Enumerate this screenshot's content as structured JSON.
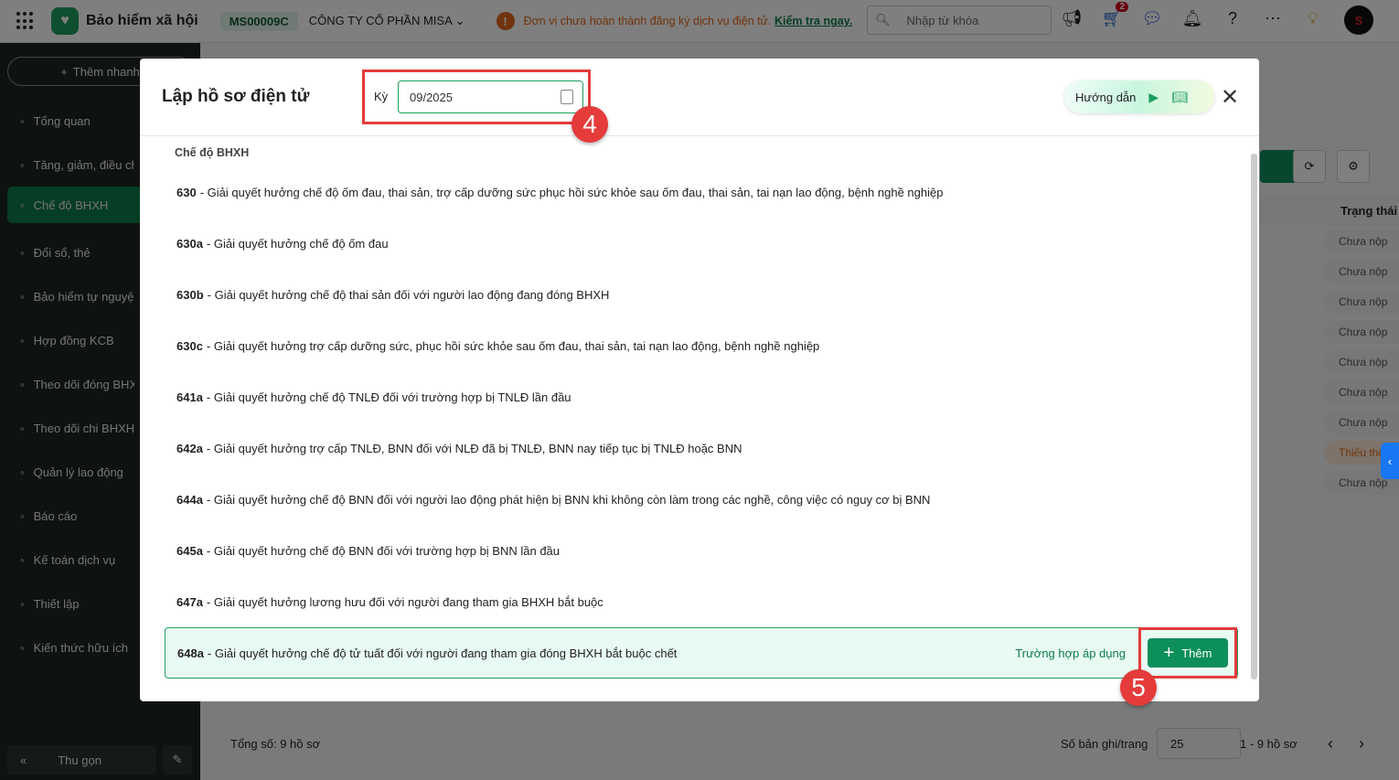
{
  "topbar": {
    "app_name": "Bảo hiểm xã hội",
    "company_code": "MS00009C",
    "company_name": "CÔNG TY CỔ PHẦN MISA",
    "warning": "Đơn vị chưa hoàn thành đăng ký dịch vụ điện tử.",
    "warning_link": "Kiểm tra ngay.",
    "search_placeholder": "Nhập từ khóa",
    "cart_badge": "2"
  },
  "sidebar": {
    "quick_add": "Thêm nhanh",
    "items": [
      {
        "label": "Tổng quan",
        "icon": "home-icon"
      },
      {
        "label": "Tăng, giảm, điều chỉnh",
        "icon": "user-icon"
      },
      {
        "label": "Chế độ BHXH",
        "icon": "shield-icon"
      },
      {
        "label": "Đổi sổ, thẻ",
        "icon": "card-icon"
      },
      {
        "label": "Bảo hiểm tự nguyện",
        "icon": "shield-icon"
      },
      {
        "label": "Hợp đồng KCB",
        "icon": "contract-icon"
      },
      {
        "label": "Theo dõi đóng BHXH",
        "icon": "doc-icon"
      },
      {
        "label": "Theo dõi chi BHXH",
        "icon": "doc-icon"
      },
      {
        "label": "Quản lý lao động",
        "icon": "users-icon"
      },
      {
        "label": "Báo cáo",
        "icon": "report-icon"
      },
      {
        "label": "Kế toán dịch vụ",
        "icon": "service-icon"
      },
      {
        "label": "Thiết lập",
        "icon": "gear-icon"
      },
      {
        "label": "Kiến thức hữu ích",
        "icon": "bulb-icon"
      }
    ],
    "collapse": "Thu gọn"
  },
  "background": {
    "column_header": "Trạng thái",
    "statuses": [
      "Chưa nộp",
      "Chưa nộp",
      "Chưa nộp",
      "Chưa nộp",
      "Chưa nộp",
      "Chưa nộp",
      "Chưa nộp",
      "Thiếu thông tin",
      "Chưa nộp"
    ],
    "total": "Tổng số: 9 hồ sơ",
    "per_page_label": "Số bản ghi/trang",
    "per_page": "25",
    "range": "1 - 9 hồ sơ"
  },
  "modal": {
    "title": "Lập hồ sơ điện tử",
    "period_label": "Kỳ",
    "period_value": "09/2025",
    "guide": "Hướng dẫn",
    "section": "Chế độ BHXH",
    "items": [
      {
        "code": "630",
        "text": "Giải quyết hưởng chế độ ốm đau, thai sản, trợ cấp dưỡng sức phục hồi sức khỏe sau ốm đau, thai sản, tai nạn lao động, bệnh nghề nghiệp"
      },
      {
        "code": "630a",
        "text": "Giải quyết hưởng chế độ ốm đau"
      },
      {
        "code": "630b",
        "text": "Giải quyết hưởng chế độ thai sản đối với người lao động đang đóng BHXH"
      },
      {
        "code": "630c",
        "text": "Giải quyết hưởng trợ cấp dưỡng sức, phục hồi sức khỏe sau ốm đau, thai sản, tai nạn lao động, bệnh nghề nghiệp"
      },
      {
        "code": "641a",
        "text": "Giải quyết hưởng chế độ TNLĐ đối với trường hợp bị TNLĐ lần đầu"
      },
      {
        "code": "642a",
        "text": "Giải quyết hưởng trợ cấp TNLĐ, BNN đối với NLĐ đã bị TNLĐ, BNN nay tiếp tục bị TNLĐ hoặc BNN"
      },
      {
        "code": "644a",
        "text": "Giải quyết hưởng chế độ BNN đối với người lao động phát hiện bị BNN khi không còn làm trong các nghề, công việc có nguy cơ bị BNN"
      },
      {
        "code": "645a",
        "text": "Giải quyết hưởng chế độ BNN đối với trường hợp bị BNN lần đầu"
      },
      {
        "code": "647a",
        "text": "Giải quyết hưởng lương hưu đối với người đang tham gia BHXH bắt buộc"
      },
      {
        "code": "648a",
        "text": "Giải quyết hưởng chế độ tử tuất đối với người đang tham gia đóng BHXH bắt buộc chết"
      }
    ],
    "apply_link": "Trường hợp áp dụng",
    "add_button": "Thêm"
  },
  "annotations": {
    "step_period": "4",
    "step_add": "5"
  },
  "colors": {
    "brand": "#0d8f5a",
    "annotation": "#e53b3b"
  }
}
